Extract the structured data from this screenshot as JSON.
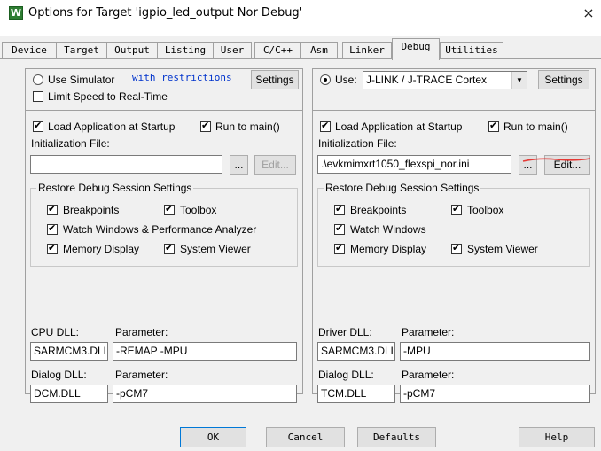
{
  "window": {
    "icon_label": "W",
    "title": "Options for Target 'igpio_led_output Nor Debug'",
    "close": "×"
  },
  "tabs": [
    "Device",
    "Target",
    "Output",
    "Listing",
    "User",
    "C/C++",
    "Asm",
    "Linker",
    "Debug",
    "Utilities"
  ],
  "active_tab": "Debug",
  "left": {
    "use_simulator": "Use Simulator",
    "with_restrictions": "with restrictions",
    "settings": "Settings",
    "limit_speed": "Limit Speed to Real-Time",
    "load_app": "Load Application at Startup",
    "run_to_main": "Run to main()",
    "init_file_label": "Initialization File:",
    "init_file_value": "",
    "browse": "...",
    "edit": "Edit...",
    "restore_group": "Restore Debug Session Settings",
    "breakpoints": "Breakpoints",
    "toolbox": "Toolbox",
    "watch_windows": "Watch Windows & Performance Analyzer",
    "memory_display": "Memory Display",
    "system_viewer": "System Viewer",
    "cpu_dll_label": "CPU DLL:",
    "cpu_param_label": "Parameter:",
    "cpu_dll_value": "SARMCM3.DLL",
    "cpu_param_value": "-REMAP -MPU",
    "dialog_dll_label": "Dialog DLL:",
    "dialog_param_label": "Parameter:",
    "dialog_dll_value": "DCM.DLL",
    "dialog_param_value": "-pCM7"
  },
  "right": {
    "use": "Use:",
    "debugger": "J-LINK / J-TRACE Cortex",
    "settings": "Settings",
    "load_app": "Load Application at Startup",
    "run_to_main": "Run to main()",
    "init_file_label": "Initialization File:",
    "init_file_value": ".\\evkmimxrt1050_flexspi_nor.ini",
    "browse": "...",
    "edit": "Edit...",
    "restore_group": "Restore Debug Session Settings",
    "breakpoints": "Breakpoints",
    "toolbox": "Toolbox",
    "watch_windows": "Watch Windows",
    "memory_display": "Memory Display",
    "system_viewer": "System Viewer",
    "driver_dll_label": "Driver DLL:",
    "driver_param_label": "Parameter:",
    "driver_dll_value": "SARMCM3.DLL",
    "driver_param_value": "-MPU",
    "dialog_dll_label": "Dialog DLL:",
    "dialog_param_label": "Parameter:",
    "dialog_dll_value": "TCM.DLL",
    "dialog_param_value": "-pCM7"
  },
  "footer": {
    "ok": "OK",
    "cancel": "Cancel",
    "defaults": "Defaults",
    "help": "Help"
  },
  "annotation_color": "#e53935"
}
